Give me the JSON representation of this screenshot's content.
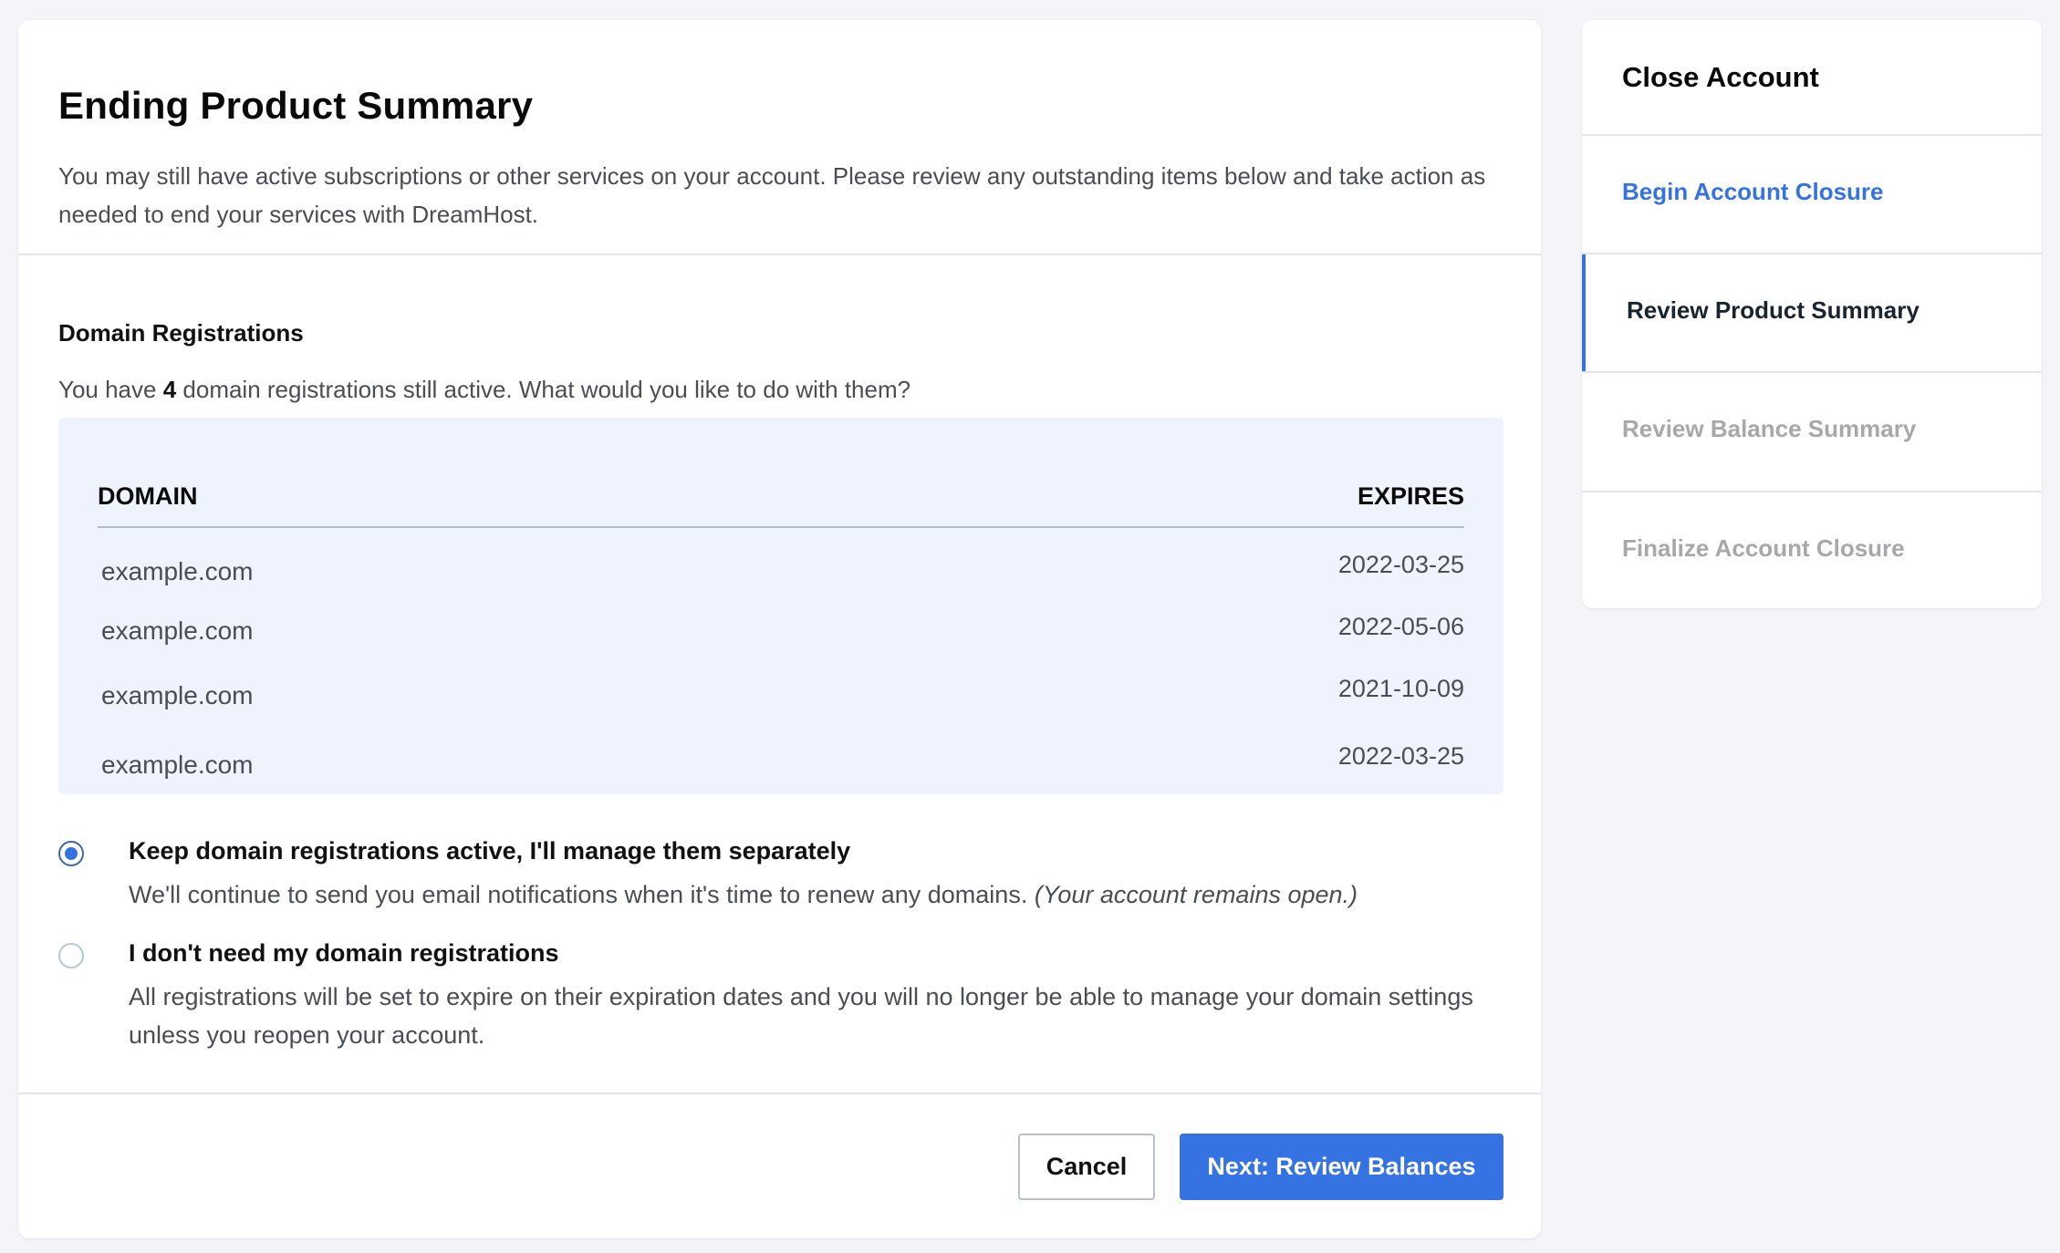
{
  "main": {
    "title": "Ending Product Summary",
    "intro": "You may still have active subscriptions or other services on your account. Please review any outstanding items below and take action as needed to end your services with DreamHost.",
    "section": {
      "title": "Domain Registrations",
      "sub_prefix": "You have ",
      "count": "4",
      "sub_suffix": " domain registrations still active. What would you like to do with them?"
    },
    "table": {
      "columns": [
        "DOMAIN",
        "EXPIRES"
      ],
      "rows": [
        {
          "domain": "example.com",
          "expires": "2022-03-25"
        },
        {
          "domain": "example.com",
          "expires": "2022-05-06"
        },
        {
          "domain": "example.com",
          "expires": "2021-10-09"
        },
        {
          "domain": "example.com",
          "expires": "2022-03-25"
        }
      ]
    },
    "options": [
      {
        "label": "Keep domain registrations active, I'll manage them separately",
        "desc": "We'll continue to send you email notifications when it's time to renew any domains. ",
        "note": "(Your account remains open.)",
        "checked": true
      },
      {
        "label": "I don't need my domain registrations",
        "desc": "All registrations will be set to expire on their expiration dates and you will no longer be able to manage your domain settings unless you reopen your account.",
        "note": "",
        "checked": false
      }
    ],
    "buttons": {
      "cancel": "Cancel",
      "next": "Next: Review Balances"
    }
  },
  "sidebar": {
    "title": "Close Account",
    "steps": [
      {
        "label": "Begin Account Closure",
        "state": "done"
      },
      {
        "label": "Review Product Summary",
        "state": "active"
      },
      {
        "label": "Review Balance Summary",
        "state": "todo"
      },
      {
        "label": "Finalize Account Closure",
        "state": "todo"
      }
    ]
  },
  "colors": {
    "accent": "#3573e3",
    "table_bg": "#eef3fd",
    "page_bg": "#f4f5f8"
  }
}
